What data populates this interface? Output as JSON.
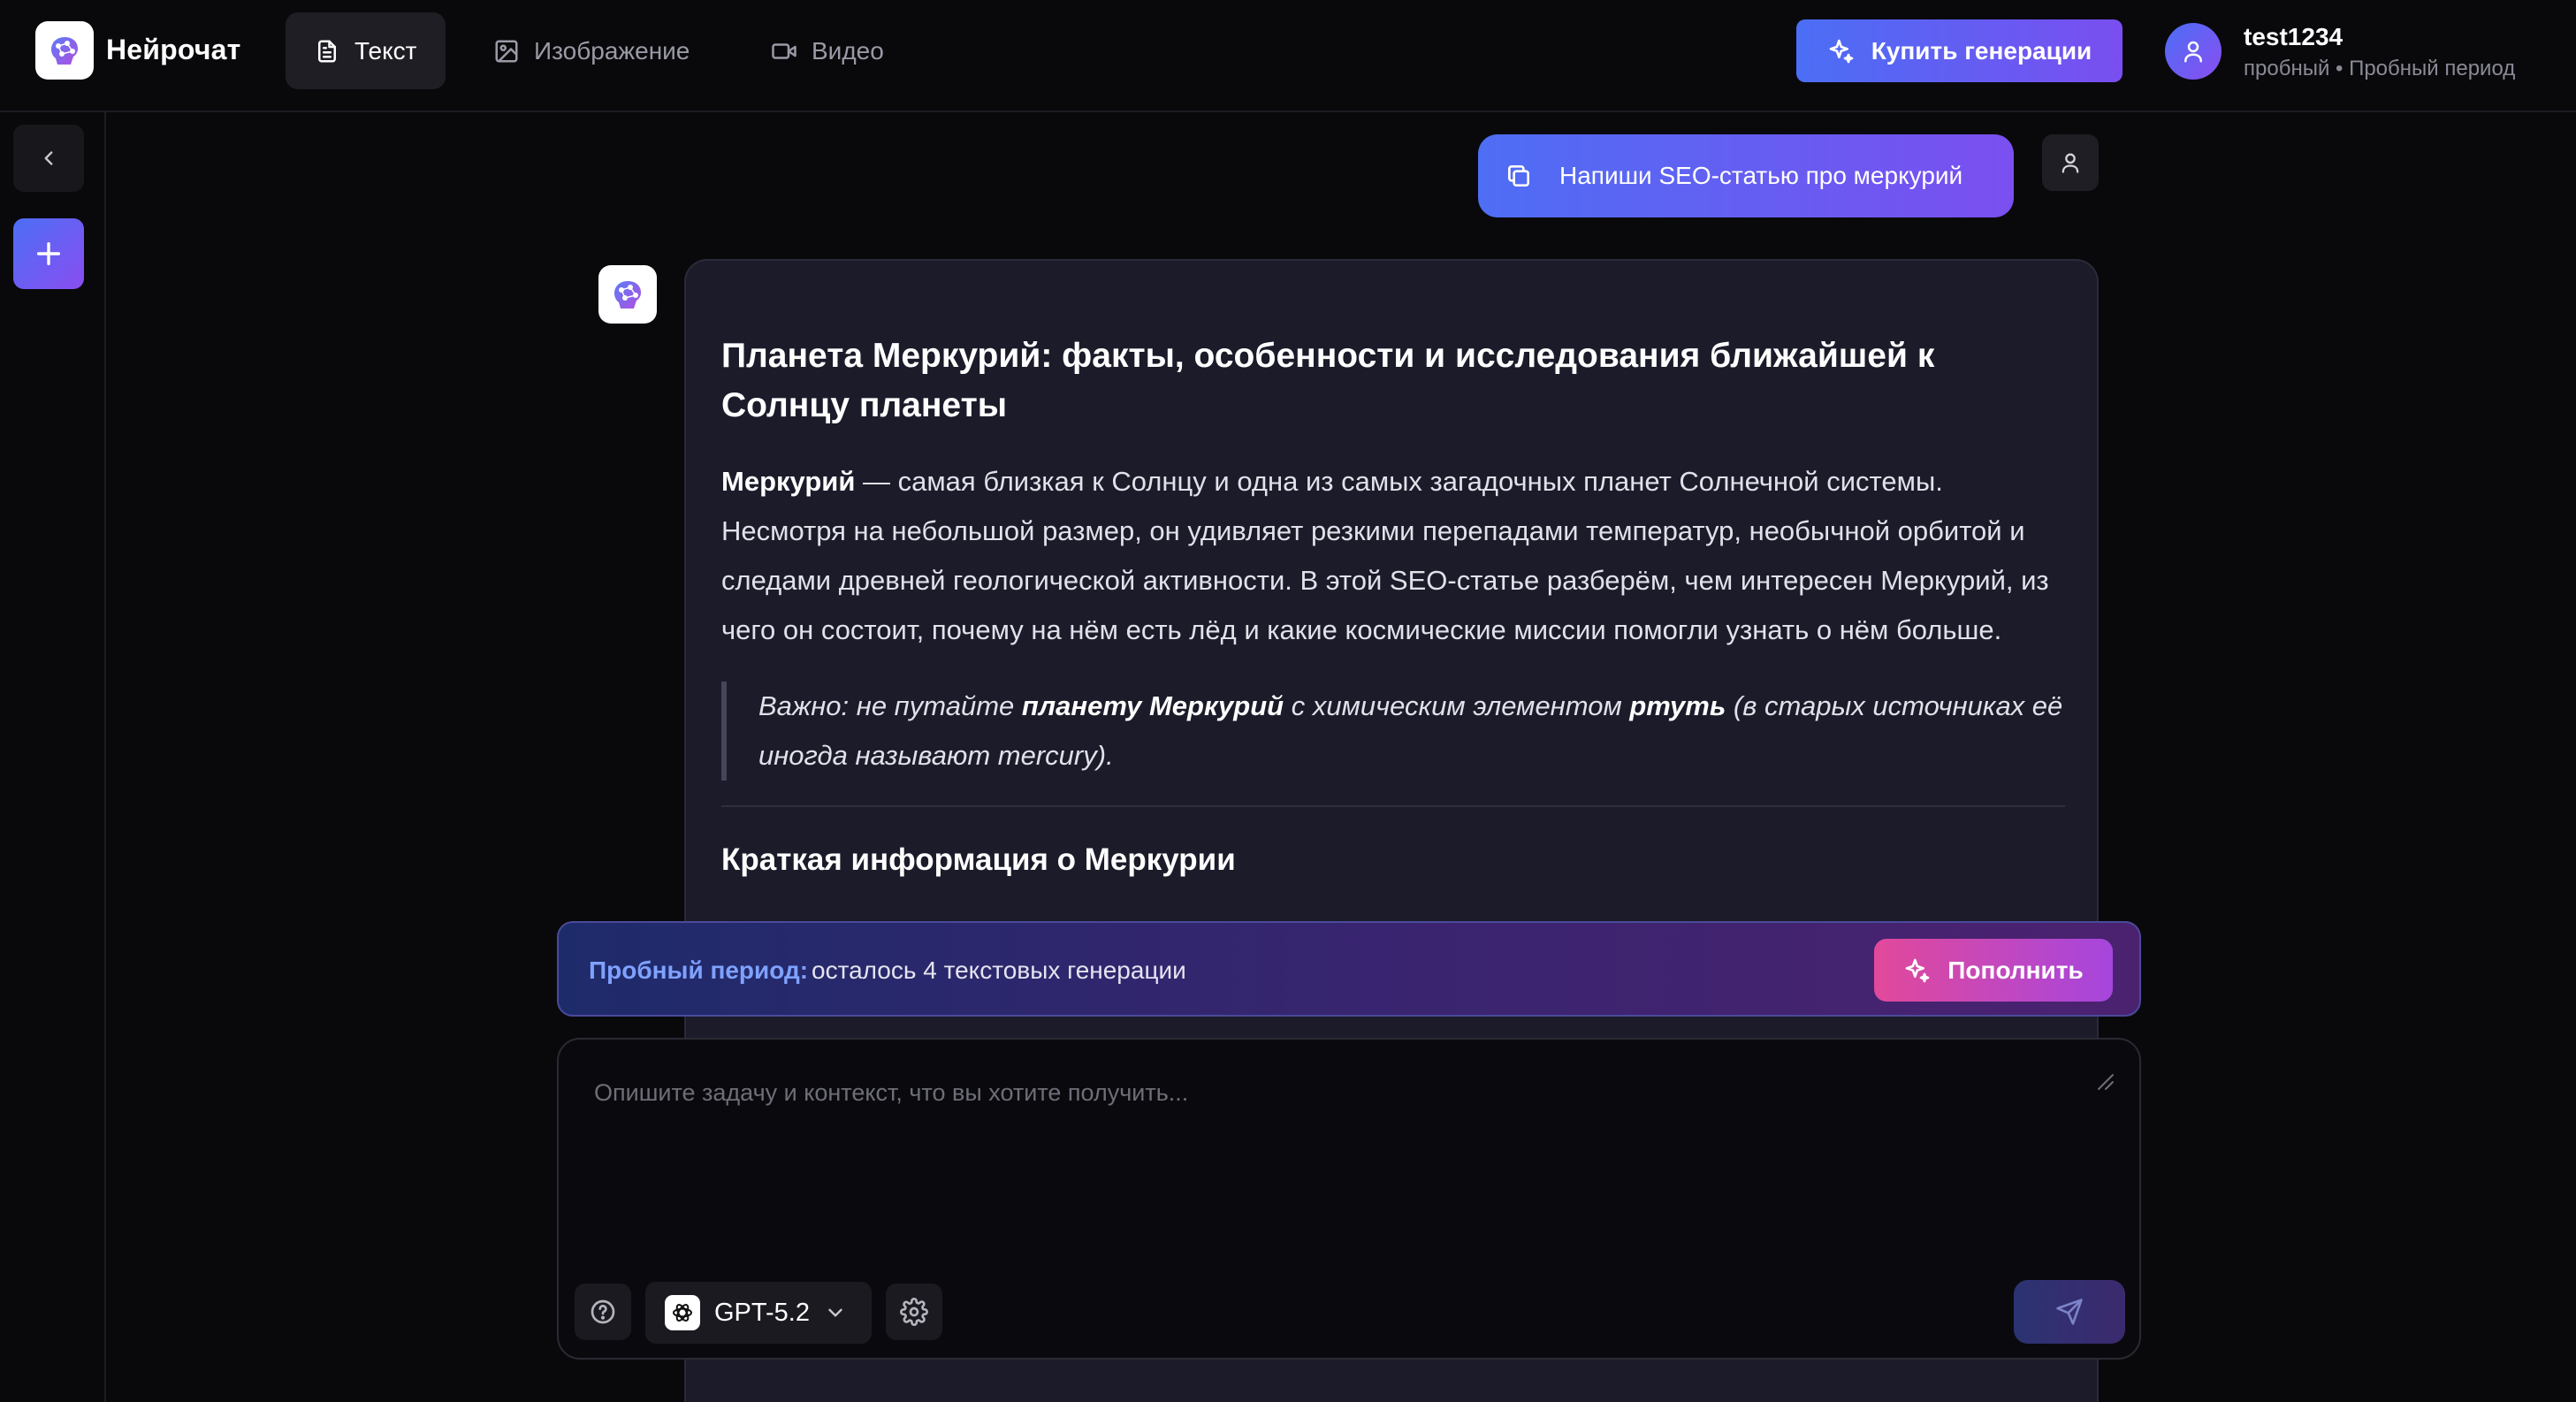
{
  "app": {
    "name": "Нейрочат"
  },
  "nav": {
    "tabs": [
      {
        "label": "Текст",
        "icon": "document-icon",
        "active": true
      },
      {
        "label": "Изображение",
        "icon": "image-icon",
        "active": false
      },
      {
        "label": "Видео",
        "icon": "video-icon",
        "active": false
      }
    ]
  },
  "header": {
    "buy_button": "Купить генерации",
    "user": {
      "name": "test1234",
      "plan": "пробный • Пробный период"
    }
  },
  "chat": {
    "user_message": "Напиши SEO-статью про меркурий",
    "bot": {
      "title": "Планета Меркурий: факты, особенности и исследования ближайшей к Солнцу планеты",
      "para_bold": "Меркурий",
      "para_rest": " — самая близкая к Солнцу и одна из самых загадочных планет Солнечной системы. Несмотря на небольшой размер, он удивляет резкими перепадами температур, необычной орбитой и следами древней геологической активности. В этой SEO-статье разберём, чем интересен Меркурий, из чего он состоит, почему на нём есть лёд и какие космические миссии помогли узнать о нём больше.",
      "quote": {
        "part1": "Важно: не путайте ",
        "bold1": "планету Меркурий",
        "part2": " с химическим элементом ",
        "bold2": "ртуть",
        "part3": " (в старых источниках её иногда называют mercury)."
      },
      "subtitle": "Краткая информация о Меркурии"
    }
  },
  "trial": {
    "label": "Пробный период:",
    "text": "осталось 4 текстовых генерации",
    "button": "Пополнить"
  },
  "composer": {
    "placeholder": "Опишите задачу и контекст, что вы хотите получить...",
    "model": "GPT-5.2"
  },
  "colors": {
    "accent_blue": "#4b6ef5",
    "accent_purple": "#8a4ef0",
    "accent_pink": "#e2499a",
    "background": "#09090c",
    "card": "#1b1b2a"
  }
}
